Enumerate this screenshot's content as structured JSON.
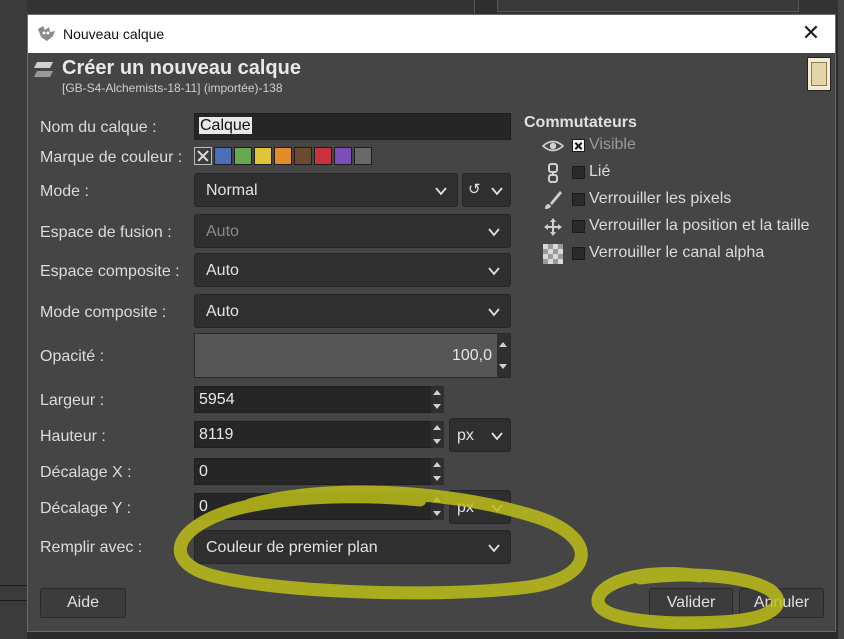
{
  "window": {
    "title": "Nouveau calque",
    "close_glyph": "✕"
  },
  "header": {
    "title": "Créer un nouveau calque",
    "subtitle": "[GB-S4-Alchemists-18-11] (importée)-138"
  },
  "form": {
    "layer_name": {
      "label": "Nom du calque :",
      "value": "Calque"
    },
    "color_tag": {
      "label": "Marque de couleur :",
      "swatches": [
        "none",
        "#4b6fb8",
        "#6aa84f",
        "#e0c43a",
        "#e38a2b",
        "#6b4a2e",
        "#c8323c",
        "#7c4fb8",
        "#6a6a6a"
      ]
    },
    "mode": {
      "label": "Mode :",
      "value": "Normal",
      "reset_glyph": "↺"
    },
    "blend_space": {
      "label": "Espace de fusion :",
      "value": "Auto"
    },
    "composite_space": {
      "label": "Espace composite :",
      "value": "Auto"
    },
    "composite_mode": {
      "label": "Mode composite :",
      "value": "Auto"
    },
    "opacity": {
      "label": "Opacité :",
      "value": "100,0"
    },
    "width": {
      "label": "Largeur :",
      "value": "5954"
    },
    "height": {
      "label": "Hauteur :",
      "value": "8119",
      "unit": "px"
    },
    "offset_x": {
      "label": "Décalage X :",
      "value": "0"
    },
    "offset_y": {
      "label": "Décalage Y :",
      "value": "0",
      "unit": "px"
    },
    "fill": {
      "label": "Remplir avec :",
      "value": "Couleur de premier plan"
    }
  },
  "switches": {
    "title": "Commutateurs",
    "items": [
      {
        "icon": "eye-icon",
        "label": "Visible",
        "checked": true
      },
      {
        "icon": "chain-icon",
        "label": "Lié",
        "checked": false
      },
      {
        "icon": "brush-icon",
        "label": "Verrouiller les pixels",
        "checked": false
      },
      {
        "icon": "move-icon",
        "label": "Verrouiller la position et la taille",
        "checked": false
      },
      {
        "icon": "checkerboard-icon",
        "label": "Verrouiller le canal alpha",
        "checked": false
      }
    ]
  },
  "buttons": {
    "help": "Aide",
    "ok": "Valider",
    "cancel": "Annuler"
  },
  "annotation": {
    "color": "#bdbd1a"
  }
}
